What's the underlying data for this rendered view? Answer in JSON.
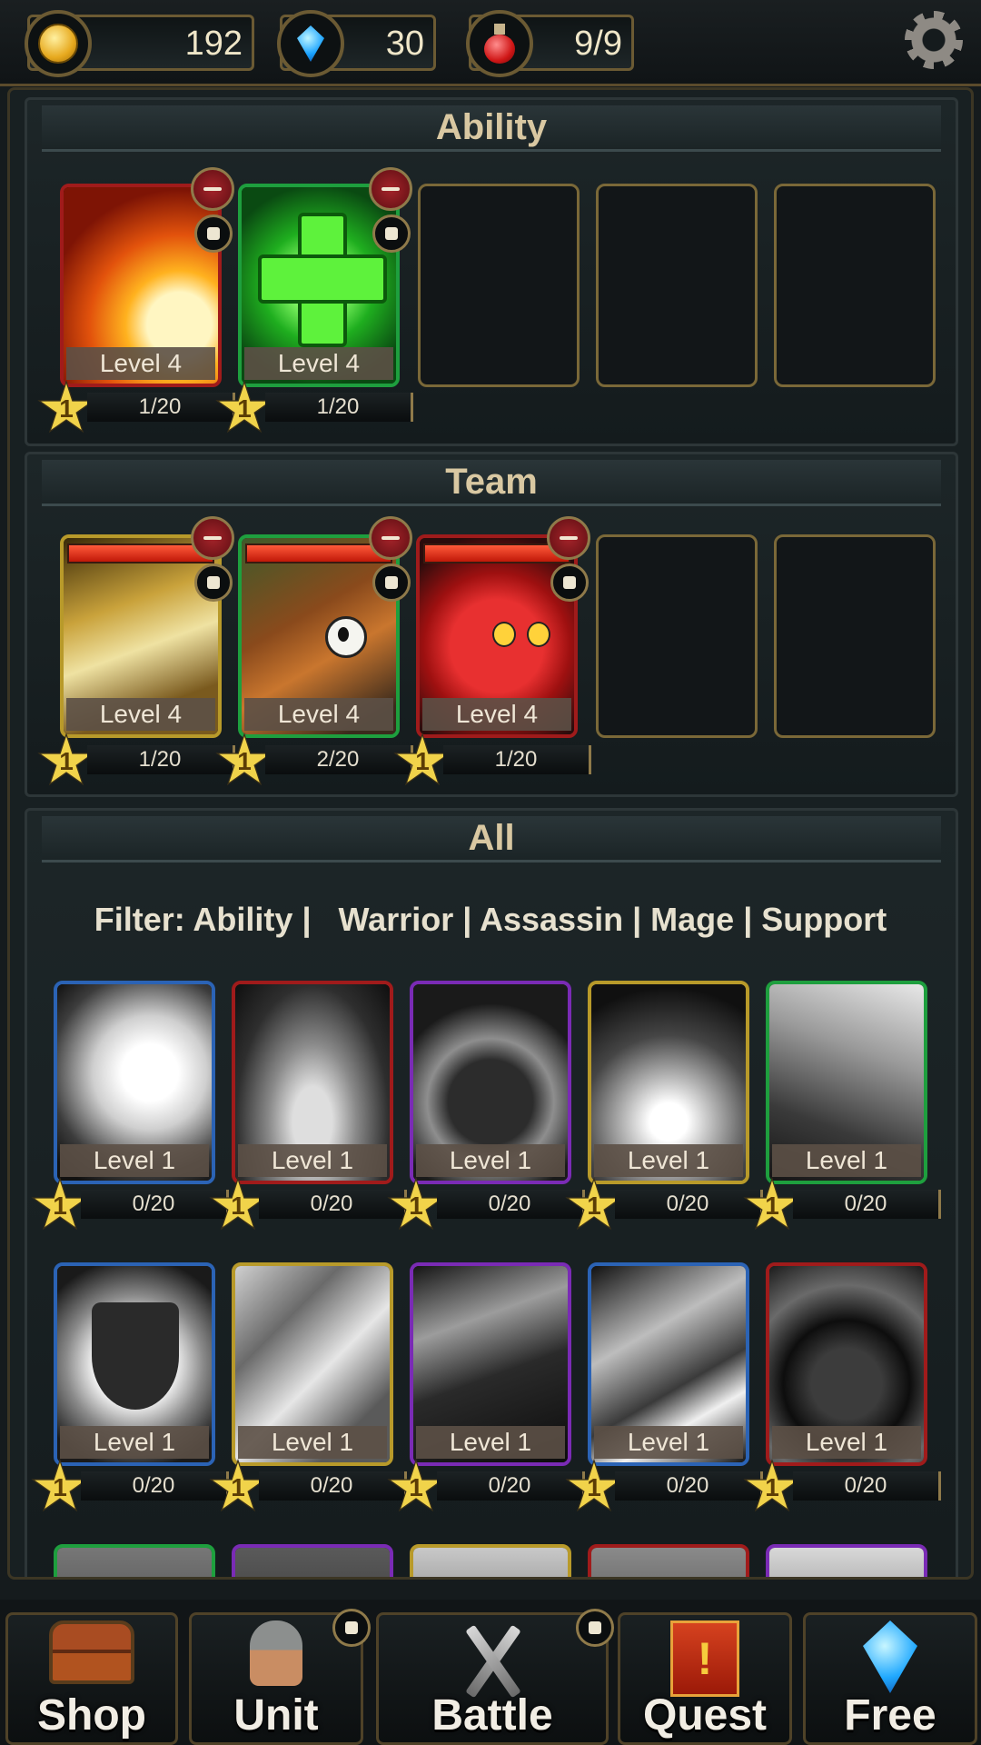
{
  "resources": {
    "gold": "192",
    "gems": "30",
    "potions": "9/9"
  },
  "settings_icon": "gear-icon",
  "ability": {
    "title": "Ability",
    "slots": [
      {
        "level": "Level 4",
        "stars": "1",
        "progress": "1/20",
        "art": "fireball",
        "border": "#a01b1b"
      },
      {
        "level": "Level 4",
        "stars": "1",
        "progress": "1/20",
        "art": "heal-cross",
        "border": "#1e9f3e"
      }
    ]
  },
  "team": {
    "title": "Team",
    "slots": [
      {
        "level": "Level 4",
        "stars": "1",
        "progress": "1/20",
        "art": "gold-knight",
        "border": "#b89a2a"
      },
      {
        "level": "Level 4",
        "stars": "1",
        "progress": "2/20",
        "art": "brown-beast",
        "border": "#1e9f3e"
      },
      {
        "level": "Level 4",
        "stars": "1",
        "progress": "1/20",
        "art": "red-imp",
        "border": "#a01b1b"
      }
    ]
  },
  "all": {
    "title": "All",
    "filter": {
      "prefix": "Filter:",
      "options": [
        "Ability",
        "Warrior",
        "Assassin",
        "Mage",
        "Support"
      ]
    },
    "row1": [
      {
        "level": "Level 1",
        "stars": "1",
        "progress": "0/20",
        "border": "#2b63b5"
      },
      {
        "level": "Level 1",
        "stars": "1",
        "progress": "0/20",
        "border": "#a01b1b"
      },
      {
        "level": "Level 1",
        "stars": "1",
        "progress": "0/20",
        "border": "#7a2bb5"
      },
      {
        "level": "Level 1",
        "stars": "1",
        "progress": "0/20",
        "border": "#b89a2a"
      },
      {
        "level": "Level 1",
        "stars": "1",
        "progress": "0/20",
        "border": "#1e9f3e"
      }
    ],
    "row2": [
      {
        "level": "Level 1",
        "stars": "1",
        "progress": "0/20",
        "border": "#2b63b5"
      },
      {
        "level": "Level 1",
        "stars": "1",
        "progress": "0/20",
        "border": "#b89a2a"
      },
      {
        "level": "Level 1",
        "stars": "1",
        "progress": "0/20",
        "border": "#7a2bb5"
      },
      {
        "level": "Level 1",
        "stars": "1",
        "progress": "0/20",
        "border": "#2b63b5"
      },
      {
        "level": "Level 1",
        "stars": "1",
        "progress": "0/20",
        "border": "#a01b1b"
      }
    ]
  },
  "nav": {
    "shop": "Shop",
    "unit": "Unit",
    "battle": "Battle",
    "quest": "Quest",
    "free": "Free"
  }
}
